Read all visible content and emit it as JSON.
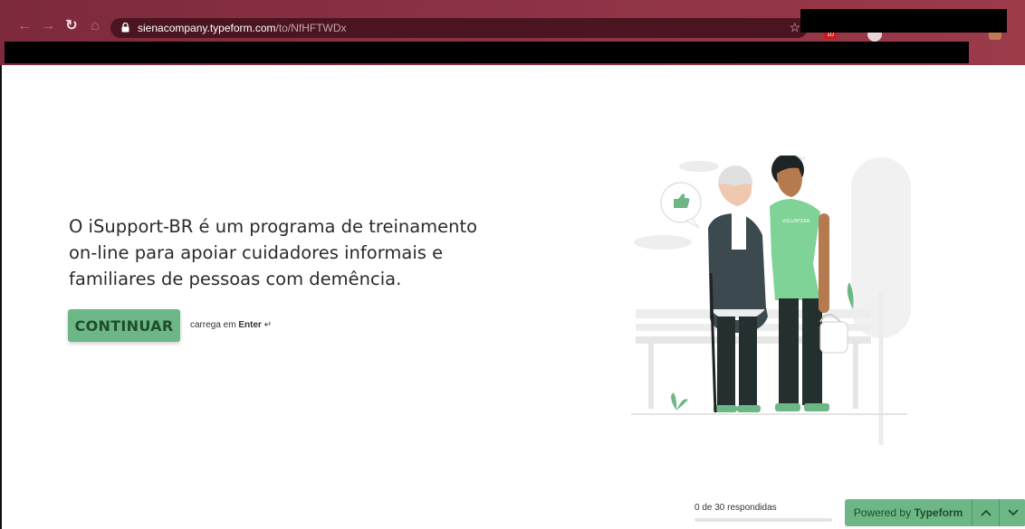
{
  "browser": {
    "url_host": "sienacompany.typeform.com",
    "url_path": "/to/NfHFTWDx",
    "ext_badge": "10",
    "icons": [
      "back-icon",
      "forward-icon",
      "reload-icon",
      "home-icon",
      "lock-icon",
      "star-icon"
    ]
  },
  "form": {
    "intro_text": "O iSupport-BR é um programa de treinamento on-line para apoiar cuidadores informais e familiares de pessoas com demência.",
    "continue_label": "CONTINUAR",
    "hint_prefix": "carrega em",
    "hint_key": "Enter",
    "hint_symbol": "↵"
  },
  "illustration": {
    "shirt_text": "VOLUNTEER"
  },
  "footer": {
    "progress_text": "0 de 30 respondidas",
    "progress_fraction": 0,
    "powered_prefix": "Powered by",
    "powered_brand": "Typeform",
    "up_icon": "chevron-up-icon",
    "down_icon": "chevron-down-icon"
  },
  "colors": {
    "accent": "#6db686",
    "accent_text": "#1f4c2c",
    "chrome": "#8e3346"
  }
}
